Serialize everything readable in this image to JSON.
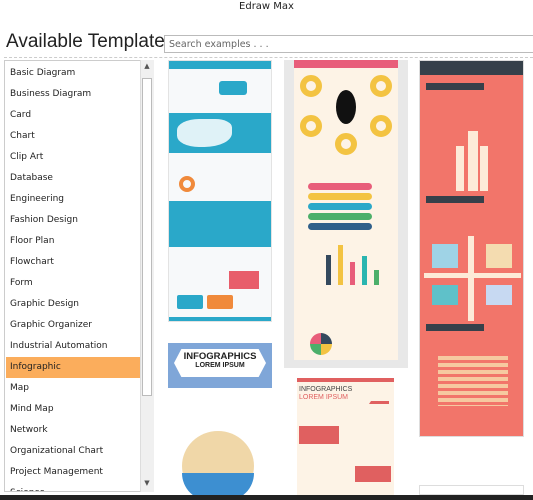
{
  "app_title": "Edraw Max",
  "heading": "Available Templates",
  "search": {
    "placeholder": "Search examples . . ."
  },
  "categories": [
    "Basic Diagram",
    "Business Diagram",
    "Card",
    "Chart",
    "Clip Art",
    "Database",
    "Engineering",
    "Fashion Design",
    "Floor Plan",
    "Flowchart",
    "Form",
    "Graphic Design",
    "Graphic Organizer",
    "Industrial Automation",
    "Infographic",
    "Map",
    "Mind Map",
    "Network",
    "Organizational Chart",
    "Project Management",
    "Science"
  ],
  "selected_category": "Infographic",
  "colors": {
    "selected": "#fbad5c",
    "salmon": "#f2756a",
    "teal": "#2aa8c9",
    "cream": "#fdf3e6"
  },
  "templates": [
    {
      "title": "INFOGRAPHICS",
      "subtitle": "LOREM IPSUM"
    },
    {
      "title": "INFOGRAPHICS",
      "subtitle": "LOREM IPSUM"
    }
  ]
}
